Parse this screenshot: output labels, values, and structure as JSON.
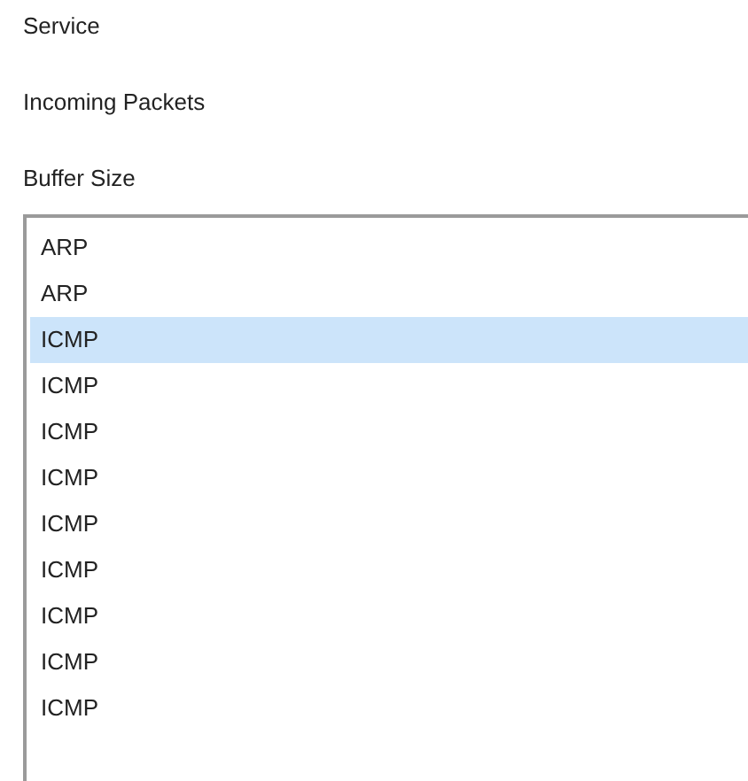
{
  "labels": [
    "Service",
    "Incoming Packets",
    "Buffer Size"
  ],
  "list": [
    {
      "text": "ARP",
      "selected": false
    },
    {
      "text": "ARP",
      "selected": false
    },
    {
      "text": "ICMP",
      "selected": true
    },
    {
      "text": "ICMP",
      "selected": false
    },
    {
      "text": "ICMP",
      "selected": false
    },
    {
      "text": "ICMP",
      "selected": false
    },
    {
      "text": "ICMP",
      "selected": false
    },
    {
      "text": "ICMP",
      "selected": false
    },
    {
      "text": "ICMP",
      "selected": false
    },
    {
      "text": "ICMP",
      "selected": false
    },
    {
      "text": "ICMP",
      "selected": false
    }
  ]
}
